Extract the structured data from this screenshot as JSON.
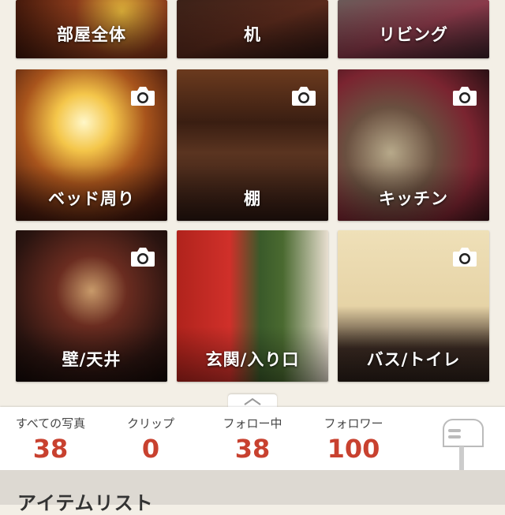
{
  "rooms": [
    {
      "label": "部屋全体"
    },
    {
      "label": "机"
    },
    {
      "label": "リビング"
    },
    {
      "label": "ベッド周り"
    },
    {
      "label": "棚"
    },
    {
      "label": "キッチン"
    },
    {
      "label": "壁/天井"
    },
    {
      "label": "玄関/入り口"
    },
    {
      "label": "バス/トイレ"
    }
  ],
  "stats": [
    {
      "title": "すべての写真",
      "value": "38"
    },
    {
      "title": "クリップ",
      "value": "0"
    },
    {
      "title": "フォロー中",
      "value": "38"
    },
    {
      "title": "フォロワー",
      "value": "100"
    }
  ],
  "section_title": "アイテムリスト",
  "colors": {
    "accent": "#c8412f",
    "background": "#f3efe6"
  },
  "icons": [
    "camera-icon",
    "chevron-up-icon",
    "mailbox-icon"
  ]
}
